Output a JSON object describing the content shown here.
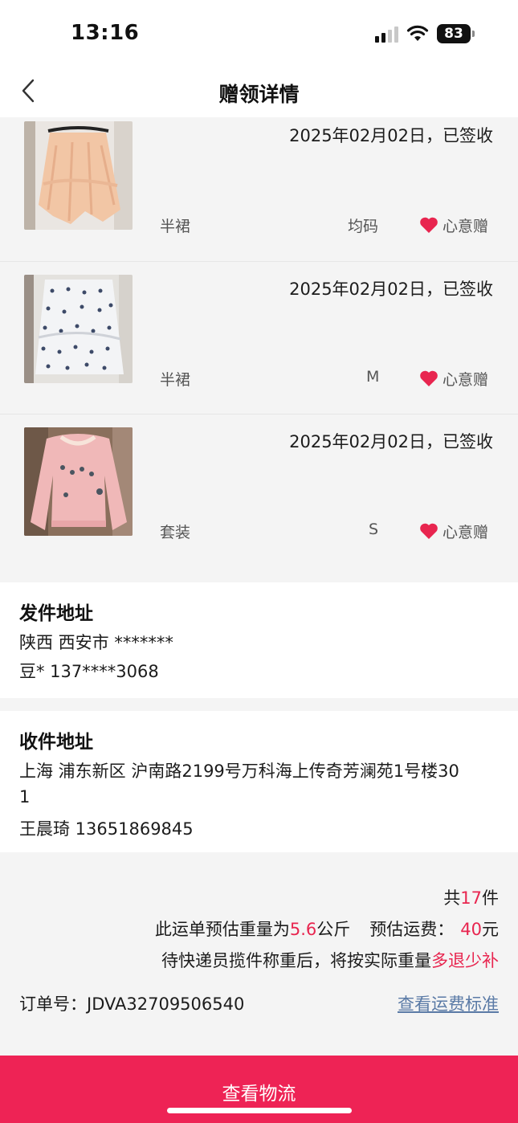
{
  "status_bar": {
    "time": "13:16",
    "battery": "83"
  },
  "nav": {
    "title": "赠领详情"
  },
  "items": [
    {
      "date_status": "2025年02月02日，已签收",
      "category": "半裙",
      "size": "均码",
      "tag": "心意赠"
    },
    {
      "date_status": "2025年02月02日，已签收",
      "category": "半裙",
      "size": "M",
      "tag": "心意赠"
    },
    {
      "date_status": "2025年02月02日，已签收",
      "category": "套装",
      "size": "S",
      "tag": "心意赠"
    }
  ],
  "sender": {
    "title": "发件地址",
    "region": "陕西 西安市 *******",
    "contact": "豆* 137****3068"
  },
  "receiver": {
    "title": "收件地址",
    "address_line1": "上海 浦东新区 沪南路2199号万科海上传奇芳澜苑1号楼30",
    "address_line2": "1",
    "contact": "王晨琦 13651869845"
  },
  "summary": {
    "count_prefix": "共",
    "count": "17",
    "count_suffix": "件",
    "weight_prefix": "此运单预估重量为",
    "weight": "5.6",
    "weight_suffix": "公斤",
    "fee_prefix": "预估运费：",
    "fee": "40",
    "fee_suffix": "元",
    "note_prefix": "待快递员揽件称重后，将按实际重量",
    "note_highlight": "多退少补",
    "order_label": "订单号：",
    "order_no": "JDVA32709506540",
    "fee_standard_link": "查看运费标准"
  },
  "bottom_button": {
    "label": "查看物流"
  },
  "colors": {
    "accent": "#ee2355",
    "highlight": "#e8254f",
    "link": "#5a7aa6"
  }
}
